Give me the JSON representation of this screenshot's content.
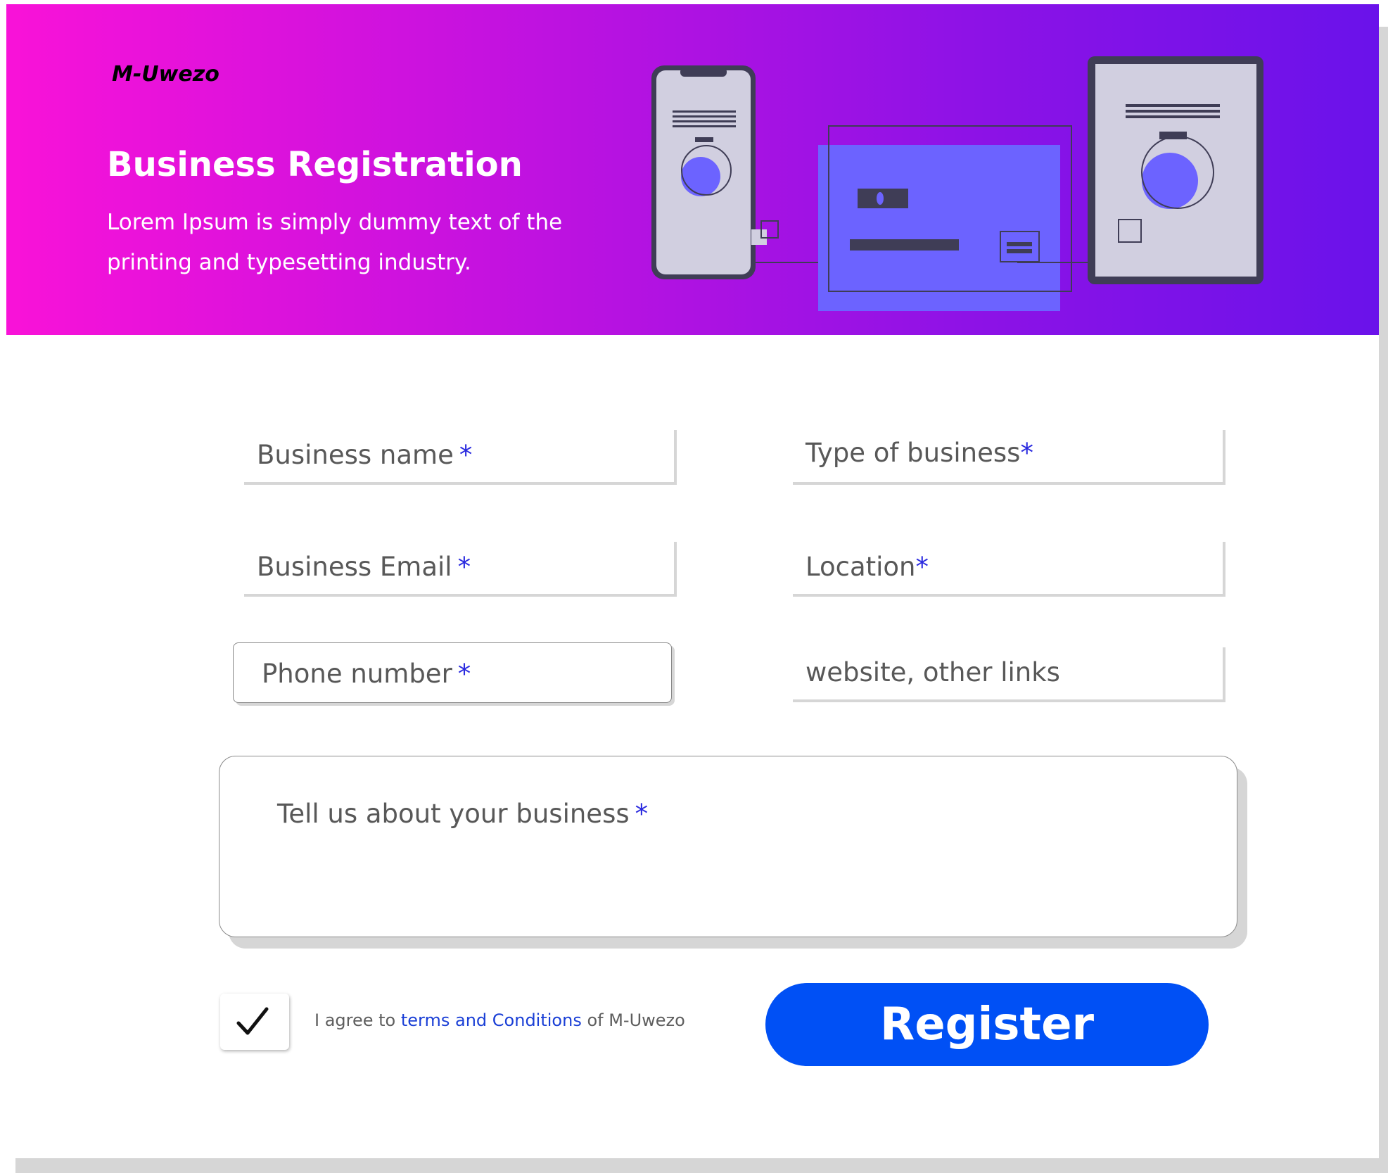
{
  "brand": {
    "logo": "M-Uwezo"
  },
  "hero": {
    "title": "Business Registration",
    "subtitle": "Lorem Ipsum is simply dummy text of the printing and typesetting industry."
  },
  "form": {
    "business_name": "Business name",
    "type_of_business": "Type of business",
    "business_email": "Business Email",
    "location": "Location",
    "phone_number": "Phone number",
    "website": "website, other links",
    "about": "Tell us about your business",
    "required_mark": "*"
  },
  "agreement": {
    "checked": true,
    "prefix": "I agree to ",
    "link": "terms and Conditions",
    "suffix": " of M-Uwezo"
  },
  "actions": {
    "register": "Register"
  },
  "colors": {
    "hero_gradient_start": "#f912d8",
    "hero_gradient_end": "#6a12ea",
    "accent": "#6c63ff",
    "required": "#2a2adf",
    "button": "#0050f5"
  }
}
